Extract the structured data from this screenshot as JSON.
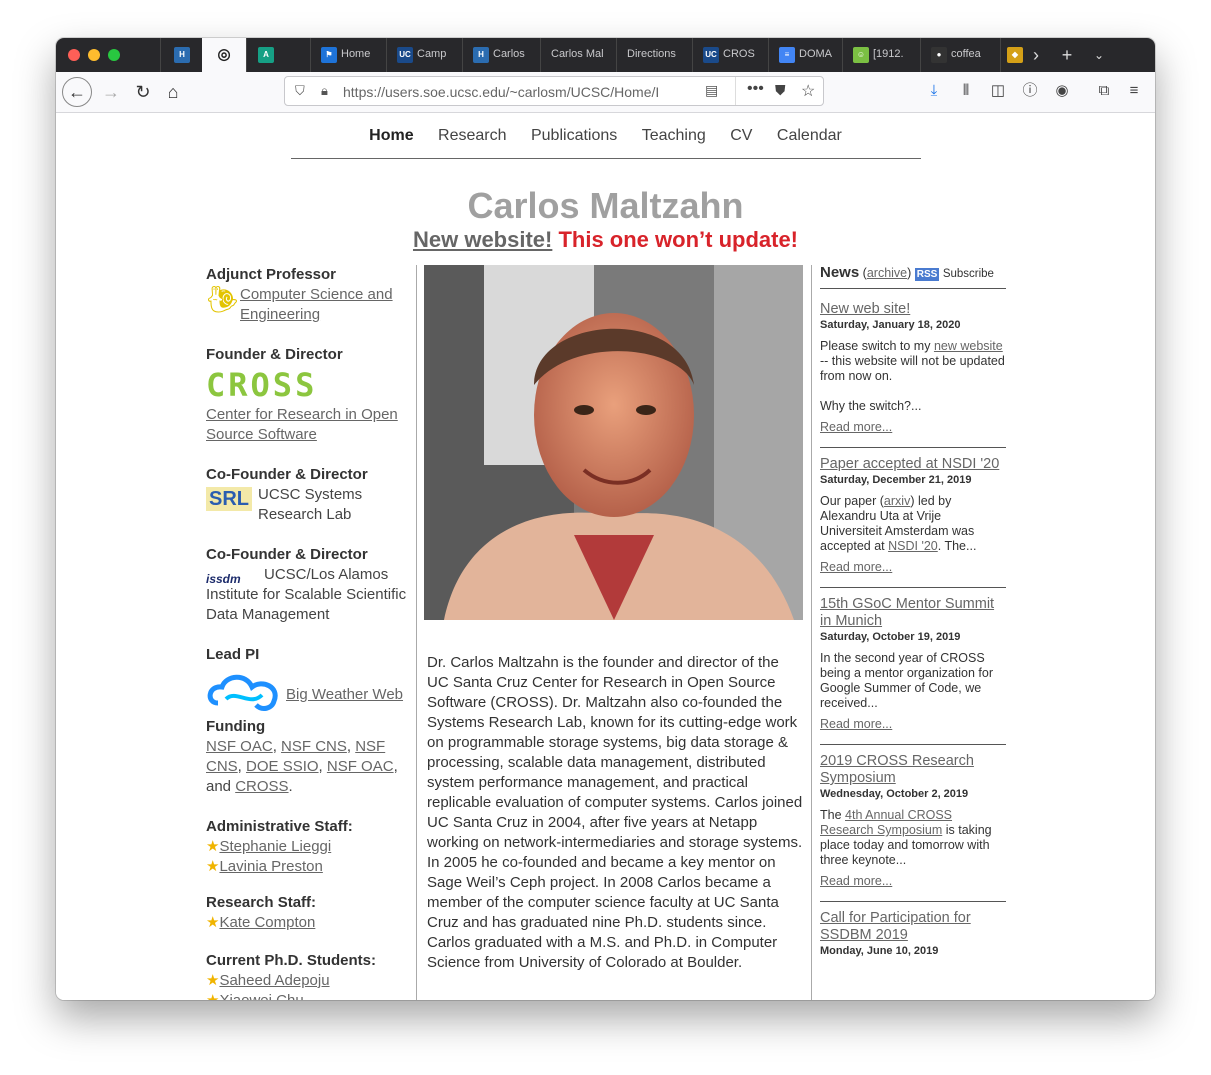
{
  "browser": {
    "tabs": [
      {
        "label": "",
        "icon": "hyperframe-icon",
        "color": "#2b6cb0",
        "glyph": "H"
      },
      {
        "label": "",
        "icon": "globe-icon",
        "color": "#222",
        "glyph": "◎",
        "active": true
      },
      {
        "label": "",
        "icon": "arrow-a-icon",
        "color": "#16a085",
        "glyph": "A"
      },
      {
        "label": "Home",
        "icon": "flag-icon",
        "color": "#1e73d8",
        "glyph": "⚑"
      },
      {
        "label": "Camp",
        "icon": "ucsc-icon",
        "color": "#1a4a8a",
        "glyph": "UC"
      },
      {
        "label": "Carlos",
        "icon": "hyperframe-icon",
        "color": "#2b6cb0",
        "glyph": "H"
      },
      {
        "label": "Carlos Mal",
        "icon": "",
        "color": "",
        "glyph": ""
      },
      {
        "label": "Directions",
        "icon": "",
        "color": "",
        "glyph": ""
      },
      {
        "label": "CROS",
        "icon": "ucsc-icon",
        "color": "#1a4a8a",
        "glyph": "UC"
      },
      {
        "label": "DOMA",
        "icon": "docs-icon",
        "color": "#4285f4",
        "glyph": "≡"
      },
      {
        "label": "[1912.",
        "icon": "smiley-icon",
        "color": "#7bc043",
        "glyph": "☺"
      },
      {
        "label": "coffea",
        "icon": "github-icon",
        "color": "#333",
        "glyph": "●"
      },
      {
        "label": "",
        "icon": "puzzle-icon",
        "color": "#d4a017",
        "glyph": "◆"
      }
    ],
    "url": "https://users.soe.ucsc.edu/~carlosm/UCSC/Home/I"
  },
  "nav": {
    "home": "Home",
    "research": "Research",
    "publications": "Publications",
    "teaching": "Teaching",
    "cv": "CV",
    "calendar": "Calendar"
  },
  "header": {
    "name": "Carlos Maltzahn",
    "new_site": "New website!",
    "warning": " This one won’t update!"
  },
  "left": {
    "adjunct_title": "Adjunct Professor",
    "adjunct_link": "Computer Science and Engineering",
    "founder_title": "Founder & Director",
    "cross_logo": "CROSS",
    "cross_link": "Center for Research in Open Source Software",
    "srl_title": "Co-Founder & Director",
    "srl_logo": "SRL",
    "srl_text": "UCSC Systems Research Lab",
    "issdm_title": "Co-Founder & Director",
    "issdm_logo": "issdm",
    "issdm_text": "UCSC/Los Alamos Institute for Scalable Scientific Data Management",
    "leadpi_title": "Lead PI",
    "bigweather_link": "Big Weather Web",
    "funding_title": "Funding",
    "funding": [
      "NSF OAC",
      "NSF CNS",
      "NSF CNS",
      "DOE SSIO",
      "NSF OAC",
      "CROSS"
    ],
    "funding_sep": [
      ", ",
      ", ",
      ", ",
      ", ",
      ", and ",
      "."
    ],
    "admin_title": "Administrative Staff:",
    "admin": [
      "Stephanie Lieggi",
      "Lavinia Preston"
    ],
    "research_title": "Research Staff:",
    "research": [
      "Kate Compton"
    ],
    "students_title": "Current Ph.D. Students:",
    "students": [
      "Saheed Adepoju",
      "Xiaowei Chu"
    ]
  },
  "bio": "Dr. Carlos Maltzahn is the founder and director of the UC Santa Cruz Center for Research in Open Source Software (CROSS). Dr. Maltzahn also co-founded the Systems Research Lab, known for its cutting-edge work on programmable storage systems, big data storage & processing, scalable data management, distributed system performance management, and practical replicable evaluation of computer systems. Carlos joined UC Santa Cruz in 2004, after five years at Netapp working on network-intermediaries and storage systems. In 2005 he co-founded and became a key mentor on Sage Weil’s Ceph project. In 2008 Carlos became a member of the computer science faculty at UC Santa Cruz and has graduated nine Ph.D. students since. Carlos graduated with a M.S. and Ph.D. in Computer Science from University of Colorado at Boulder.",
  "news": {
    "title": "News",
    "archive": "archive",
    "rss": "RSS",
    "subscribe": "Subscribe",
    "read_more": "Read more...",
    "items": [
      {
        "title": "New web site!",
        "date": "Saturday, January 18, 2020",
        "pre": "Please switch to my ",
        "link": "new website",
        "post": " -- this website will not be updated from now on.\n\nWhy the switch?..."
      },
      {
        "title": "Paper accepted at NSDI '20",
        "date": "Saturday, December 21, 2019",
        "pre": "Our paper (",
        "link": "arxiv",
        "post": ") led by Alexandru Uta at Vrije Universiteit Amsterdam was accepted at ",
        "link2": "NSDI '20",
        "post2": ". The..."
      },
      {
        "title": "15th GSoC Mentor Summit in Munich",
        "date": "Saturday, October 19, 2019",
        "pre": "In the second year of CROSS being a mentor organization for Google Summer of Code, we received...",
        "link": "",
        "post": ""
      },
      {
        "title": "2019 CROSS Research Symposium",
        "date": "Wednesday, October 2, 2019",
        "pre": "The ",
        "link": "4th Annual CROSS Research Symposium",
        "post": " is taking place today and tomorrow with three keynote..."
      },
      {
        "title": "Call for Participation for SSDBM 2019",
        "date": "Monday, June 10, 2019",
        "pre": "",
        "link": "",
        "post": ""
      }
    ]
  }
}
